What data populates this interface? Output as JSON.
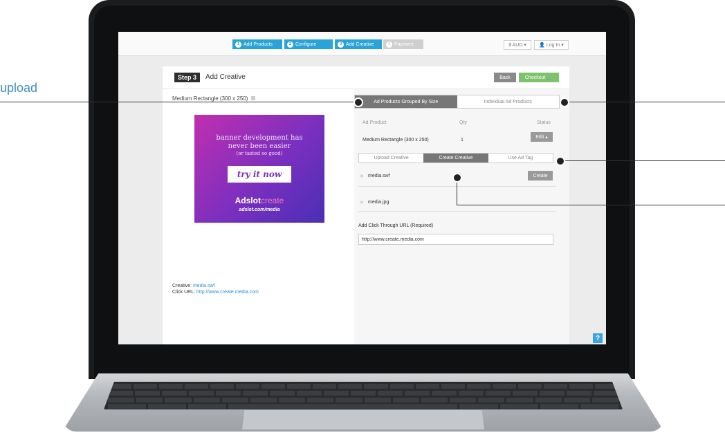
{
  "annotation": {
    "upload_label": "upload"
  },
  "topbar": {
    "steps": [
      {
        "num": "1",
        "label": "Add Products"
      },
      {
        "num": "2",
        "label": "Configure"
      },
      {
        "num": "3",
        "label": "Add Creative"
      },
      {
        "num": "4",
        "label": "Payment"
      }
    ],
    "currency": "$ AUD",
    "login": "Log In"
  },
  "header": {
    "step_badge": "Step 3",
    "title": "Add Creative",
    "back_label": "Back",
    "checkout_label": "Checkout"
  },
  "left": {
    "product_name": "Medium Rectangle (300 x 250)",
    "banner": {
      "line1": "banner development has",
      "line2": "never been easier",
      "line3": "(or tasted so good)",
      "cta": "try it now",
      "brand_bold": "Adslot",
      "brand_light": "create",
      "url": "adslot.com/media"
    },
    "creative_label": "Creative:",
    "creative_value": "media.swf",
    "click_label": "Click URL:",
    "click_value": "http://www.create.media.com"
  },
  "right": {
    "tabs": [
      "Ad Products Grouped By Size",
      "Individual Ad Products"
    ],
    "columns": [
      "Ad Product",
      "Qty",
      "Status"
    ],
    "row": {
      "product": "Medium Rectangle (300 x 250)",
      "qty": "1",
      "edit": "Edit"
    },
    "subtabs": [
      "Upload Creative",
      "Create Creative",
      "Use Ad Tag"
    ],
    "files": [
      "media.swf",
      "media.jpg"
    ],
    "create_label": "Create",
    "url_label": "Add Click Through URL (Required)",
    "url_value": "http://www.create.media.com"
  },
  "help": "?",
  "colors": {
    "accent": "#2aa3d8",
    "checkout": "#7dc36b",
    "link": "#2a8fd6"
  }
}
